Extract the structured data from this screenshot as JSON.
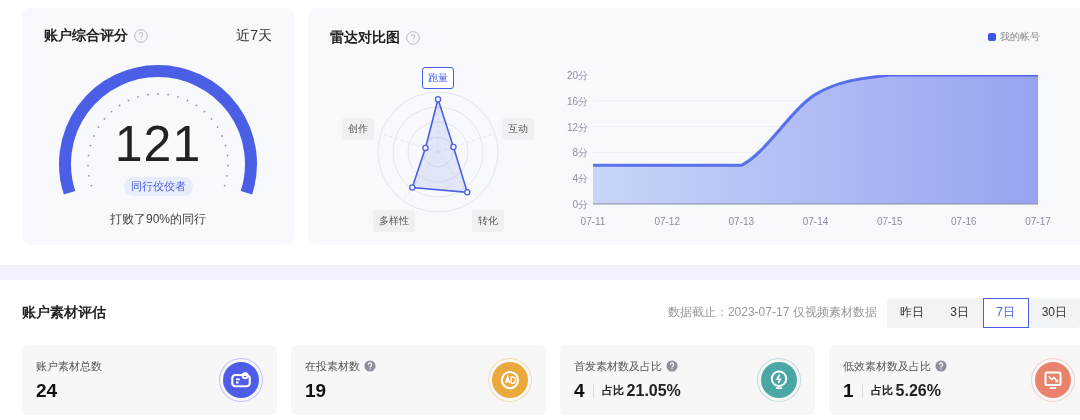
{
  "score_card": {
    "title": "账户综合评分",
    "period": "近7天",
    "score": "121",
    "badge": "同行佼佼者",
    "caption": "打败了90%的同行"
  },
  "radar_card": {
    "title": "雷达对比图",
    "radar_labels": [
      {
        "text": "跑量",
        "selected": true
      },
      {
        "text": "互动",
        "selected": false
      },
      {
        "text": "转化",
        "selected": false
      },
      {
        "text": "多样性",
        "selected": false
      },
      {
        "text": "创作",
        "selected": false
      }
    ],
    "chart_data": {
      "type": "area",
      "categories": [
        "07-11",
        "07-12",
        "07-13",
        "07-14",
        "07-15",
        "07-16",
        "07-17"
      ],
      "series": [
        {
          "name": "我的帐号",
          "color": "#3b55e6",
          "values": [
            6,
            6,
            6,
            17,
            20,
            20,
            20
          ]
        }
      ],
      "grid": true,
      "ylim": [
        0,
        20
      ],
      "yticks": [
        {
          "value": 0,
          "label": "0分"
        },
        {
          "value": 4,
          "label": "4分"
        },
        {
          "value": 8,
          "label": "8分"
        },
        {
          "value": 12,
          "label": "12分"
        },
        {
          "value": 16,
          "label": "16分"
        },
        {
          "value": 20,
          "label": "20分"
        }
      ]
    }
  },
  "materials": {
    "title": "账户素材评估",
    "note": "数据截止：2023-07-17 仅视频素材数据",
    "tabs": [
      {
        "label": "昨日",
        "selected": false
      },
      {
        "label": "3日",
        "selected": false
      },
      {
        "label": "7日",
        "selected": true
      },
      {
        "label": "30日",
        "selected": false
      }
    ],
    "cards": [
      {
        "label": "账户素材总数",
        "help": false,
        "value": "24",
        "kind": "id-card",
        "color": "#4f5ce8"
      },
      {
        "label": "在投素材数",
        "help": true,
        "value": "19",
        "kind": "ad",
        "color": "#e9a93b"
      },
      {
        "label": "首发素材数及占比",
        "help": true,
        "value": "4",
        "ratio_label": "占比",
        "ratio": "21.05%",
        "kind": "bolt",
        "color": "#4ba6a6"
      },
      {
        "label": "低效素材数及占比",
        "help": true,
        "value": "1",
        "ratio_label": "占比",
        "ratio": "5.26%",
        "kind": "trend-down",
        "color": "#e9836b"
      }
    ]
  }
}
